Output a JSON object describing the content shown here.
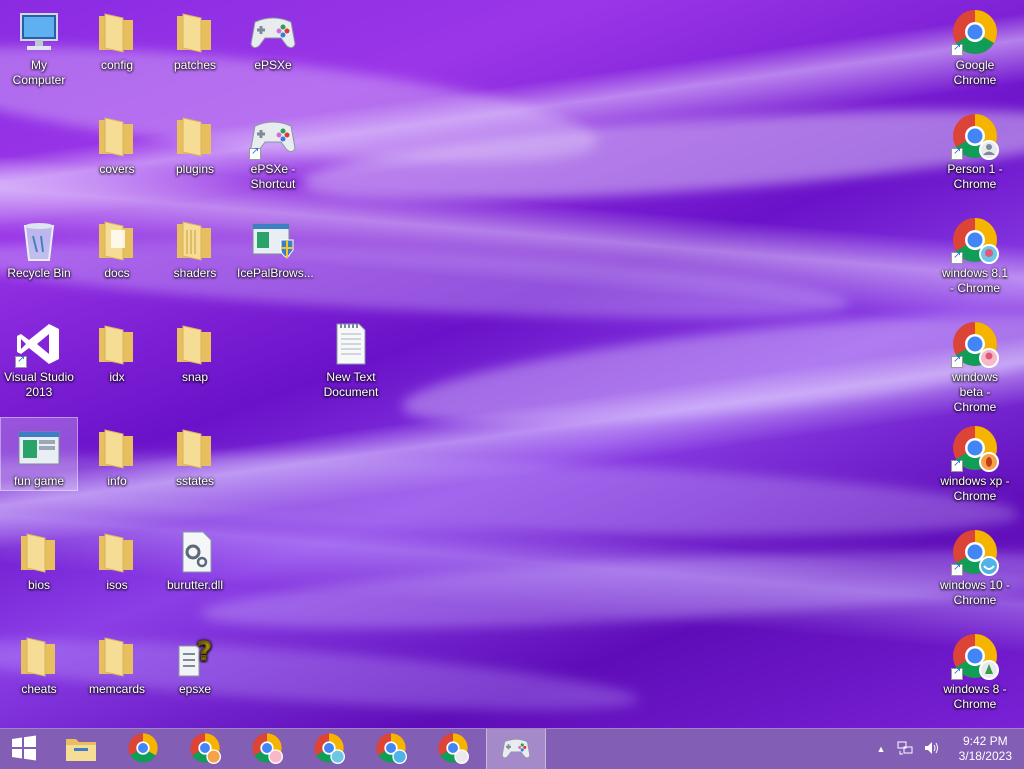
{
  "desktop": {
    "icons": [
      {
        "label": "My Computer"
      },
      {
        "label": "config"
      },
      {
        "label": "patches"
      },
      {
        "label": "ePSXe"
      },
      {
        "label": "covers"
      },
      {
        "label": "plugins"
      },
      {
        "label": "ePSXe - Shortcut"
      },
      {
        "label": "Recycle Bin"
      },
      {
        "label": "docs"
      },
      {
        "label": "shaders"
      },
      {
        "label": "IcePalBrows..."
      },
      {
        "label": "Visual Studio 2013"
      },
      {
        "label": "idx"
      },
      {
        "label": "snap"
      },
      {
        "label": "New Text Document"
      },
      {
        "label": "fun game"
      },
      {
        "label": "info"
      },
      {
        "label": "sstates"
      },
      {
        "label": "bios"
      },
      {
        "label": "isos"
      },
      {
        "label": "burutter.dll"
      },
      {
        "label": "cheats"
      },
      {
        "label": "memcards"
      },
      {
        "label": "epsxe"
      },
      {
        "label": "Google Chrome"
      },
      {
        "label": "Person 1 - Chrome"
      },
      {
        "label": "windows 8.1 - Chrome"
      },
      {
        "label": "windows beta - Chrome"
      },
      {
        "label": "windows xp - Chrome"
      },
      {
        "label": "windows 10 - Chrome"
      },
      {
        "label": "windows 8 - Chrome"
      }
    ]
  },
  "taskbar": {
    "clock_time": "9:42 PM",
    "clock_date": "3/18/2023"
  },
  "colors": {
    "wallpaper": "#7a22d6",
    "taskbar": "#7850af",
    "folder": "#f3d27a",
    "chrome_red": "#db4437",
    "chrome_green": "#0f9d58",
    "chrome_yellow": "#f4b400",
    "chrome_blue": "#4285f4"
  }
}
